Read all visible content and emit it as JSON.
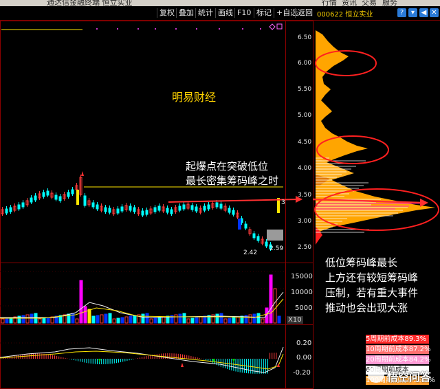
{
  "title_bar": {
    "text": "通达信金融终端  恒立实业",
    "right_menu": [
      "行情",
      "资讯",
      "交易",
      "服务"
    ]
  },
  "toolbar": {
    "buttons": [
      "复权",
      "叠加",
      "统计",
      "画线",
      "F10",
      "标记",
      "+自选",
      "返回"
    ],
    "stock_code": "000622 恒立实业"
  },
  "price_axis": {
    "ticks": [
      "6.50",
      "6.00",
      "5.50",
      "5.00",
      "4.50",
      "4.00",
      "3.50",
      "3.00",
      "2.50"
    ]
  },
  "volume_axis": {
    "ticks": [
      "15000",
      "10000",
      "5000"
    ],
    "unit": "X10"
  },
  "macd_axis": {
    "ticks": [
      "0.20",
      "0.00",
      "-0.20"
    ]
  },
  "price_marks": {
    "low": "2.42",
    "close": "2.59",
    "top_marker": "3"
  },
  "annotations": {
    "watermark": "明易财经",
    "breakout_note": [
      "起爆点在突破低位",
      "最长密集筹码峰之时"
    ],
    "analysis_note": [
      "低位筹码峰最长",
      "上方还有较短筹码峰",
      "压制，若有重大事件",
      "推动也会出现大涨"
    ]
  },
  "cost_list": [
    {
      "label": "5周期前成本89.3%",
      "bg": "#ff2a2a",
      "fg": "#ffffff"
    },
    {
      "label": "10周期前成本87.2%",
      "bg": "#ff7070",
      "fg": "#ffffff"
    },
    {
      "label": "20周期前成本84.2%",
      "bg": "#ff9ad5",
      "fg": "#ffffff"
    },
    {
      "label": "60周期前成本",
      "bg": "#ffffff",
      "fg": "#333333"
    },
    {
      "label": "100周期前成本56.3%",
      "bg": "#ffa030",
      "fg": "#ffffff"
    }
  ],
  "watermark_logo": "悟空问答",
  "colors": {
    "up": "#ff3c3c",
    "down": "#00ffff",
    "yellow": "#ffe600",
    "orange": "#ffa500",
    "magenta": "#ff00ff",
    "blue": "#0033ff"
  }
}
